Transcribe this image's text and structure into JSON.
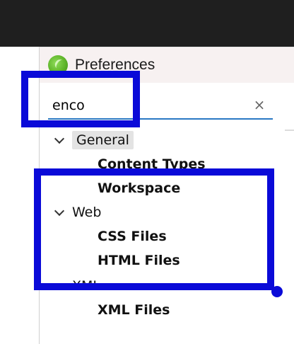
{
  "window": {
    "title": "Preferences"
  },
  "filter": {
    "value": "enco",
    "clear_icon": "×"
  },
  "tree": {
    "items": [
      {
        "type": "category",
        "label": "General",
        "selected": true
      },
      {
        "type": "page",
        "label": "Content Types"
      },
      {
        "type": "page",
        "label": "Workspace"
      },
      {
        "type": "category",
        "label": "Web"
      },
      {
        "type": "page",
        "label": "CSS Files"
      },
      {
        "type": "page",
        "label": "HTML Files"
      },
      {
        "type": "category",
        "label": "XML"
      },
      {
        "type": "page",
        "label": "XML Files"
      }
    ]
  },
  "annotation_color": "#0a0ad8",
  "icons": {
    "app": "app-logo-icon",
    "clear": "clear-icon",
    "expand": "chevron-down-icon"
  }
}
